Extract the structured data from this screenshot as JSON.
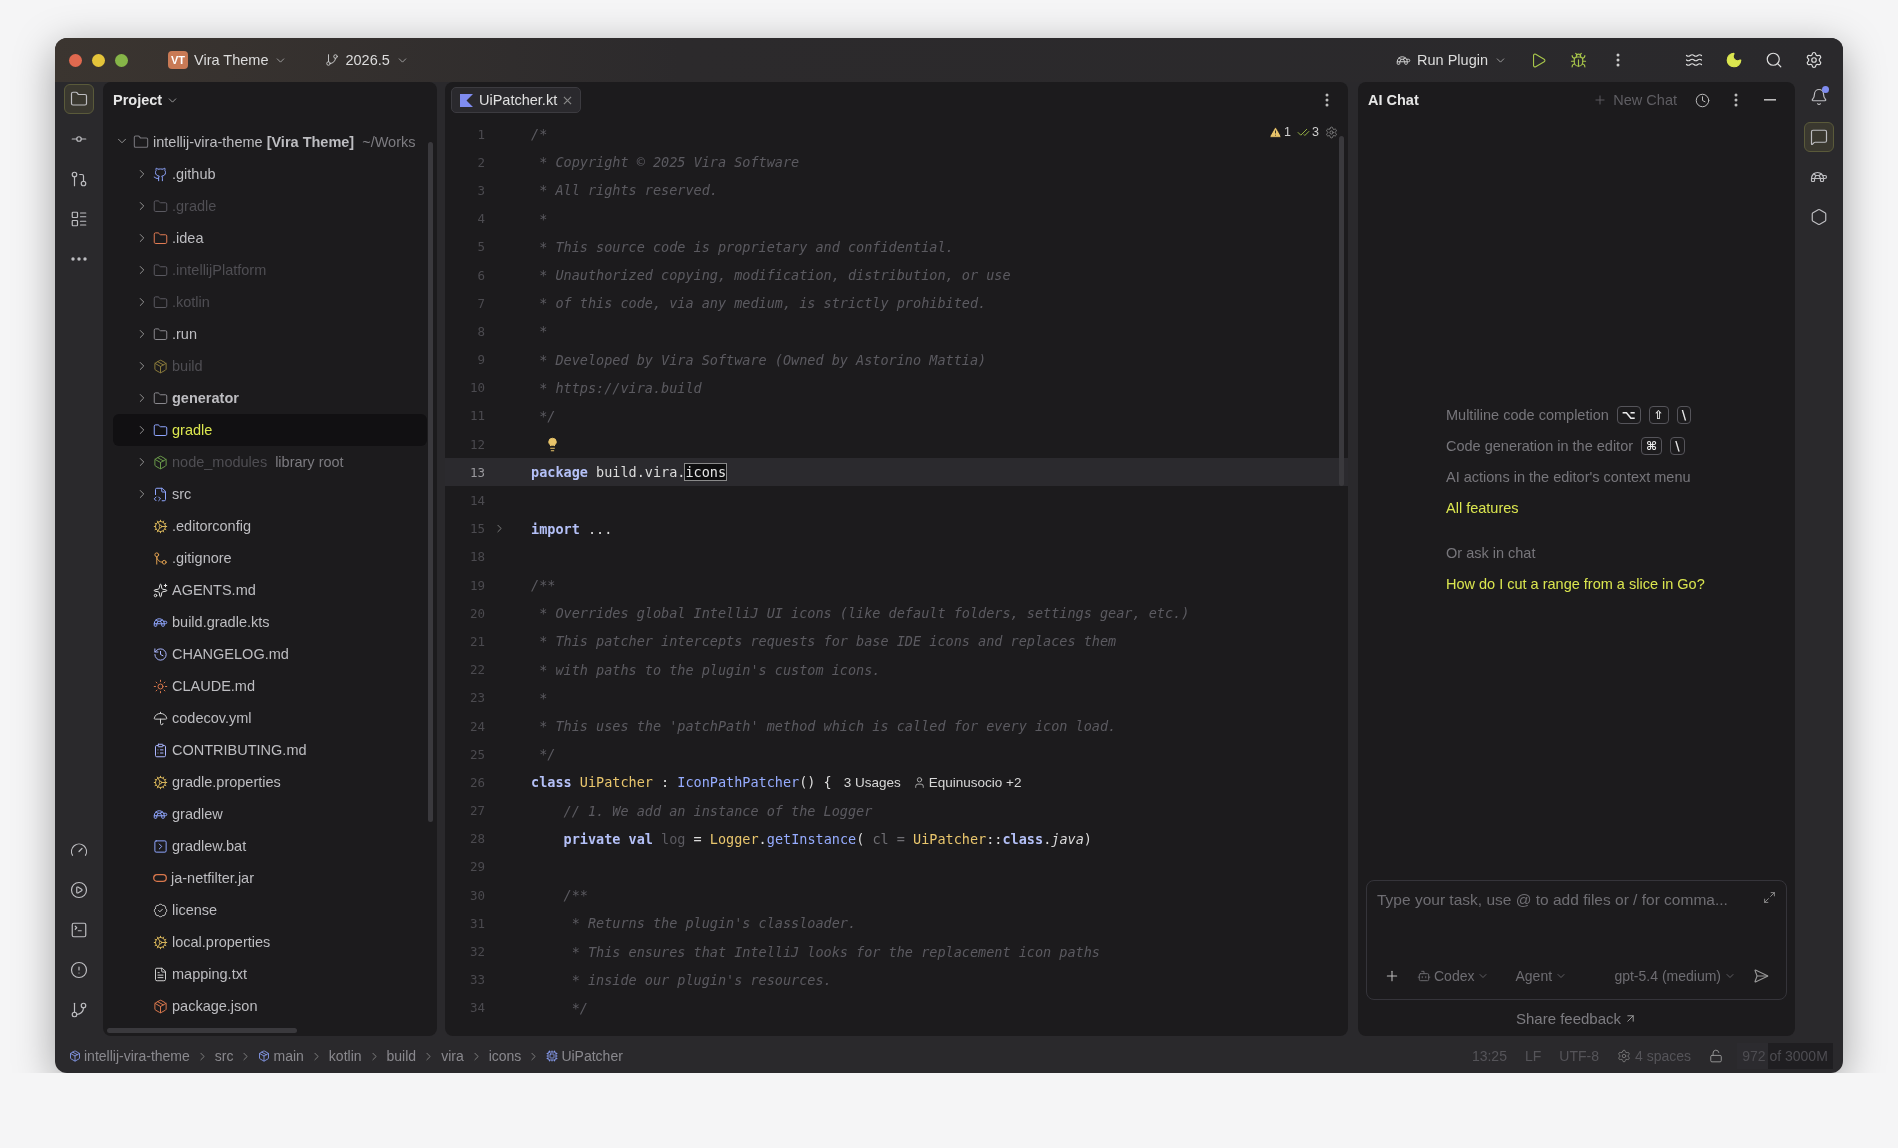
{
  "title_bar": {
    "project_badge": "VT",
    "project": "Vira Theme",
    "branch": "2026.5",
    "run_config": "Run Plugin"
  },
  "left_toolbar": [
    {
      "selected": true
    },
    {
      "selected": false
    },
    {
      "selected": false
    },
    {
      "selected": false
    },
    {
      "selected": false
    }
  ],
  "left_toolbar_bottom": [
    {
      "selected": false
    },
    {
      "selected": false
    },
    {
      "selected": false
    },
    {
      "selected": false
    },
    {
      "selected": false
    }
  ],
  "project_panel": {
    "title": "Project",
    "root": {
      "label": "intellij-vira-theme **[Vira Theme]**",
      "path": "~/Works",
      "expanded": true,
      "children": [
        {
          "kind": "folder",
          "label": ".github",
          "dimmed": false,
          "bold": false,
          "selected": false,
          "expanded": false
        },
        {
          "kind": "folder",
          "label": ".gradle",
          "dimmed": true,
          "bold": false,
          "selected": false,
          "expanded": false
        },
        {
          "kind": "folder",
          "label": ".idea",
          "dimmed": false,
          "bold": false,
          "selected": false,
          "expanded": false
        },
        {
          "kind": "folder",
          "label": ".intellijPlatform",
          "dimmed": true,
          "bold": false,
          "selected": false,
          "expanded": false
        },
        {
          "kind": "folder",
          "label": ".kotlin",
          "dimmed": true,
          "bold": false,
          "selected": false,
          "expanded": false
        },
        {
          "kind": "folder",
          "label": ".run",
          "dimmed": false,
          "bold": false,
          "selected": false,
          "expanded": false
        },
        {
          "kind": "folder",
          "label": "build",
          "dimmed": true,
          "bold": false,
          "selected": false,
          "expanded": false
        },
        {
          "kind": "folder",
          "label": "generator",
          "dimmed": false,
          "bold": true,
          "selected": false,
          "expanded": false
        },
        {
          "kind": "folder",
          "label": "gradle",
          "dimmed": false,
          "bold": false,
          "selected": true,
          "expanded": false
        },
        {
          "kind": "folder",
          "label": "node_modules",
          "suffix": "library root",
          "dimmed": true,
          "bold": false,
          "selected": false,
          "expanded": false
        },
        {
          "kind": "folder",
          "label": "src",
          "dimmed": false,
          "bold": false,
          "selected": false,
          "expanded": false
        },
        {
          "kind": "file",
          "label": ".editorconfig",
          "selected": false
        },
        {
          "kind": "file",
          "label": ".gitignore",
          "selected": false
        },
        {
          "kind": "file",
          "label": "AGENTS.md",
          "selected": false
        },
        {
          "kind": "file",
          "label": "build.gradle.kts",
          "selected": false
        },
        {
          "kind": "file",
          "label": "CHANGELOG.md",
          "selected": false
        },
        {
          "kind": "file",
          "label": "CLAUDE.md",
          "selected": false
        },
        {
          "kind": "file",
          "label": "codecov.yml",
          "selected": false
        },
        {
          "kind": "file",
          "label": "CONTRIBUTING.md",
          "selected": false
        },
        {
          "kind": "file",
          "label": "gradle.properties",
          "selected": false
        },
        {
          "kind": "file",
          "label": "gradlew",
          "selected": false
        },
        {
          "kind": "file",
          "label": "gradlew.bat",
          "selected": false
        },
        {
          "kind": "file",
          "label": "ja-netfilter.jar",
          "selected": false
        },
        {
          "kind": "file",
          "label": "license",
          "selected": false
        },
        {
          "kind": "file",
          "label": "local.properties",
          "selected": false
        },
        {
          "kind": "file",
          "label": "mapping.txt",
          "selected": false
        },
        {
          "kind": "file",
          "label": "package.json",
          "selected": false
        }
      ]
    }
  },
  "editor": {
    "tabs": [
      {
        "label": "UiPatcher.kt",
        "selected": true
      }
    ],
    "warnings": "1",
    "checks": "3",
    "lines": [
      {
        "number": "1",
        "tokens": [
          {
            "kind": "comment",
            "text": "/*"
          }
        ]
      },
      {
        "number": "2",
        "tokens": [
          {
            "kind": "comment",
            "text": " * Copyright © 2025 Vira Software"
          }
        ]
      },
      {
        "number": "3",
        "tokens": [
          {
            "kind": "comment",
            "text": " * All rights reserved."
          }
        ]
      },
      {
        "number": "4",
        "tokens": [
          {
            "kind": "comment",
            "text": " *"
          }
        ]
      },
      {
        "number": "5",
        "tokens": [
          {
            "kind": "comment",
            "text": " * This source code is proprietary and confidential."
          }
        ]
      },
      {
        "number": "6",
        "tokens": [
          {
            "kind": "comment",
            "text": " * Unauthorized copying, modification, distribution, or use"
          }
        ]
      },
      {
        "number": "7",
        "tokens": [
          {
            "kind": "comment",
            "text": " * of this code, via any medium, is strictly prohibited."
          }
        ]
      },
      {
        "number": "8",
        "tokens": [
          {
            "kind": "comment",
            "text": " *"
          }
        ]
      },
      {
        "number": "9",
        "tokens": [
          {
            "kind": "comment",
            "text": " * Developed by Vira Software (Owned by Astorino Mattia)"
          }
        ]
      },
      {
        "number": "10",
        "tokens": [
          {
            "kind": "comment",
            "text": " * https://vira.build"
          }
        ]
      },
      {
        "number": "11",
        "tokens": [
          {
            "kind": "comment",
            "text": " */"
          }
        ]
      },
      {
        "number": "12",
        "bulb": true
      },
      {
        "number": "13",
        "current": true,
        "tokens": [
          {
            "kind": "keyword",
            "text": "package"
          },
          {
            "kind": "text",
            "text": " build.vira."
          },
          {
            "kind": "boxed",
            "text": "icons"
          }
        ]
      },
      {
        "number": "14"
      },
      {
        "number": "15",
        "folded": true,
        "tokens": [
          {
            "kind": "keyword",
            "text": "import"
          },
          {
            "kind": "text",
            "text": " ..."
          }
        ]
      },
      {
        "number": "18"
      },
      {
        "number": "19",
        "tokens": [
          {
            "kind": "comment",
            "text": "/**"
          }
        ]
      },
      {
        "number": "20",
        "tokens": [
          {
            "kind": "comment",
            "text": " * Overrides global IntelliJ UI icons (like default folders, settings gear, etc.)"
          }
        ]
      },
      {
        "number": "21",
        "tokens": [
          {
            "kind": "comment",
            "text": " * This patcher intercepts requests for base IDE icons and replaces them"
          }
        ]
      },
      {
        "number": "22",
        "tokens": [
          {
            "kind": "comment",
            "text": " * with paths to the plugin's custom icons."
          }
        ]
      },
      {
        "number": "23",
        "tokens": [
          {
            "kind": "comment",
            "text": " *"
          }
        ]
      },
      {
        "number": "24",
        "tokens": [
          {
            "kind": "comment",
            "text": " * This uses the 'patchPath' method which is called for every icon load."
          }
        ]
      },
      {
        "number": "25",
        "tokens": [
          {
            "kind": "comment",
            "text": " */"
          }
        ]
      },
      {
        "number": "26",
        "tokens": [
          {
            "kind": "keyword",
            "text": "class"
          },
          {
            "kind": "type",
            "text": " UiPatcher"
          },
          {
            "kind": "text",
            "text": " : "
          },
          {
            "kind": "call",
            "text": "IconPathPatcher"
          },
          {
            "kind": "text",
            "text": "() {"
          },
          {
            "kind": "usages",
            "text": "3 Usages"
          },
          {
            "kind": "author",
            "text": "Equinusocio +2"
          }
        ]
      },
      {
        "number": "27",
        "tokens": [
          {
            "kind": "comment",
            "text": "    // 1. We add an instance of the Logger"
          }
        ]
      },
      {
        "number": "28",
        "tokens": [
          {
            "kind": "keyword",
            "text": "    private val"
          },
          {
            "kind": "unused",
            "text": " log"
          },
          {
            "kind": "text",
            "text": " = "
          },
          {
            "kind": "type",
            "text": "Logger"
          },
          {
            "kind": "text",
            "text": "."
          },
          {
            "kind": "call",
            "text": "getInstance"
          },
          {
            "kind": "text",
            "text": "( "
          },
          {
            "kind": "hint",
            "text": "cl ="
          },
          {
            "kind": "type",
            "text": " UiPatcher"
          },
          {
            "kind": "text",
            "text": "::"
          },
          {
            "kind": "keyword",
            "text": "class"
          },
          {
            "kind": "text",
            "text": "."
          },
          {
            "kind": "italic",
            "text": "java"
          },
          {
            "kind": "text",
            "text": ")"
          }
        ]
      },
      {
        "number": "29"
      },
      {
        "number": "30",
        "tokens": [
          {
            "kind": "comment",
            "text": "    /**"
          }
        ]
      },
      {
        "number": "31",
        "tokens": [
          {
            "kind": "comment",
            "text": "     * Returns the plugin's classloader."
          }
        ]
      },
      {
        "number": "32",
        "tokens": [
          {
            "kind": "comment",
            "text": "     * This ensures that IntelliJ looks for the replacement icon paths"
          }
        ]
      },
      {
        "number": "33",
        "tokens": [
          {
            "kind": "comment",
            "text": "     * inside our plugin's resources."
          }
        ]
      },
      {
        "number": "34",
        "tokens": [
          {
            "kind": "comment",
            "text": "     */"
          }
        ]
      }
    ]
  },
  "ai_chat": {
    "title": "AI Chat",
    "new_chat": "New Chat",
    "features": [
      {
        "label": "Multiline code completion",
        "keys": [
          "⌥",
          "⇧",
          "\\"
        ]
      },
      {
        "label": "Code generation in the editor",
        "keys": [
          "⌘",
          "\\"
        ]
      },
      {
        "label": "AI actions in the editor's context menu"
      }
    ],
    "all_features": "All features",
    "ask_label": "Or ask in chat",
    "suggestion": "How do I cut a range from a slice in Go?",
    "input": {
      "placeholder": "Type your task, use @ to add files or / for comma..."
    },
    "provider": "Codex",
    "mode": "Agent",
    "model": "gpt-5.4 (medium)",
    "feedback": "Share feedback"
  },
  "right_toolbar": [
    {
      "selected": true
    },
    {
      "selected": false
    },
    {
      "selected": false
    }
  ],
  "breadcrumbs": [
    "intellij-vira-theme",
    "src",
    "main",
    "kotlin",
    "build",
    "vira",
    "icons",
    "UiPatcher"
  ],
  "status_bar": {
    "position": "13:25",
    "line_ending": "LF",
    "encoding": "UTF-8",
    "indent": "4 spaces",
    "memory": {
      "text": "972 of 3000M",
      "level": 0.324
    }
  }
}
